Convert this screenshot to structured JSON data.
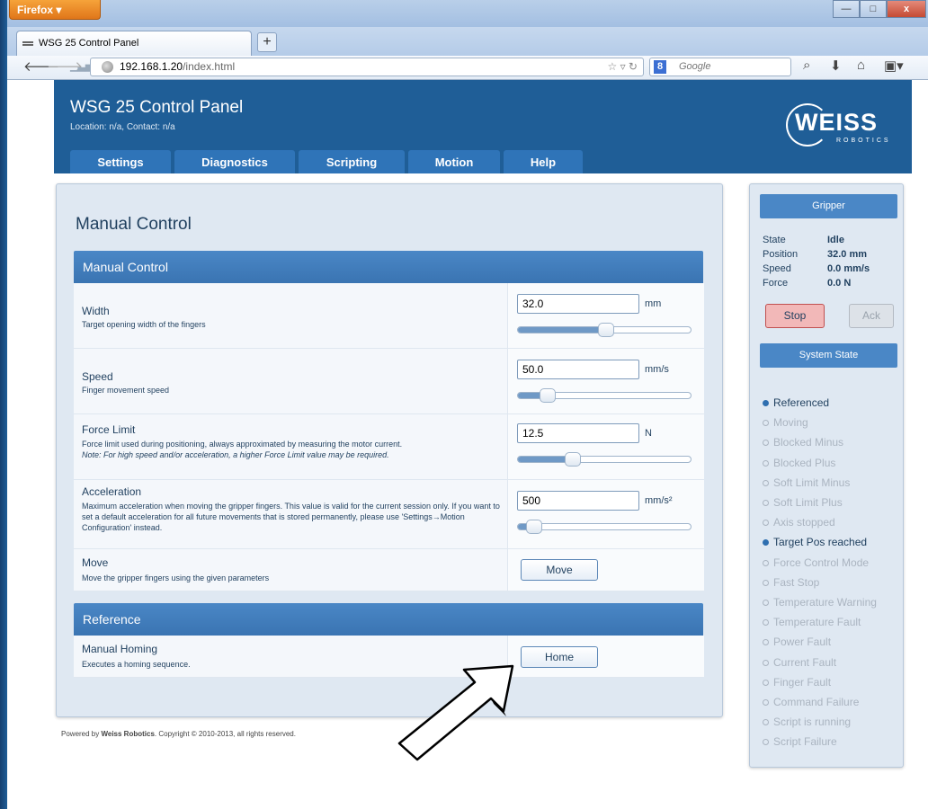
{
  "browser": {
    "menu_label": "Firefox ▾",
    "tab_title": "WSG 25 Control Panel",
    "new_tab": "+",
    "url_host": "192.168.1.20",
    "url_path": "/index.html",
    "search_placeholder": "Google",
    "window_min": "—",
    "window_max": "□",
    "window_close": "x"
  },
  "header": {
    "title": "WSG 25 Control Panel",
    "subtitle": "Location: n/a, Contact: n/a",
    "logo_text": "WEISS",
    "logo_sub": "ROBOTICS"
  },
  "nav": [
    "Settings",
    "Diagnostics",
    "Scripting",
    "Motion",
    "Help"
  ],
  "page_title": "Manual Control",
  "sections": {
    "manual": "Manual Control",
    "reference": "Reference"
  },
  "controls": {
    "width": {
      "label": "Width",
      "desc": "Target opening width of the fingers",
      "value": "32.0",
      "unit": "mm",
      "level": 0.51
    },
    "speed": {
      "label": "Speed",
      "desc": "Finger movement speed",
      "value": "50.0",
      "unit": "mm/s",
      "level": 0.14
    },
    "force": {
      "label": "Force Limit",
      "desc": "Force limit used during positioning, always approximated by measuring the motor current.",
      "note": "Note: For high speed and/or acceleration, a higher Force Limit value may be required.",
      "value": "12.5",
      "unit": "N",
      "level": 0.3
    },
    "accel": {
      "label": "Acceleration",
      "desc": "Maximum acceleration when moving the gripper fingers. This value is valid for the current session only. If you want to set a default acceleration for all future movements that is stored permanently, please use 'Settings→Motion Configuration' instead.",
      "value": "500",
      "unit": "mm/s²",
      "level": 0.05
    },
    "move": {
      "label": "Move",
      "desc": "Move the gripper fingers using the given parameters",
      "button": "Move"
    },
    "homing": {
      "label": "Manual Homing",
      "desc": "Executes a homing sequence.",
      "button": "Home"
    }
  },
  "footer": {
    "prefix": "Powered by ",
    "brand": "Weiss Robotics",
    "rest": ". Copyright © 2010-2013, all rights reserved."
  },
  "gripper": {
    "title": "Gripper",
    "rows": [
      {
        "label": "State",
        "value": "Idle"
      },
      {
        "label": "Position",
        "value": "32.0 mm"
      },
      {
        "label": "Speed",
        "value": "0.0 mm/s"
      },
      {
        "label": "Force",
        "value": "0.0 N"
      }
    ],
    "stop": "Stop",
    "ack": "Ack"
  },
  "system_state": {
    "title": "System State",
    "flags": [
      {
        "label": "Referenced",
        "on": true
      },
      {
        "label": "Moving",
        "on": false
      },
      {
        "label": "Blocked Minus",
        "on": false
      },
      {
        "label": "Blocked Plus",
        "on": false
      },
      {
        "label": "Soft Limit Minus",
        "on": false
      },
      {
        "label": "Soft Limit Plus",
        "on": false
      },
      {
        "label": "Axis stopped",
        "on": false
      },
      {
        "label": "Target Pos reached",
        "on": true
      },
      {
        "label": "Force Control Mode",
        "on": false
      },
      {
        "label": "Fast Stop",
        "on": false
      },
      {
        "label": "Temperature Warning",
        "on": false
      },
      {
        "label": "Temperature Fault",
        "on": false
      },
      {
        "label": "Power Fault",
        "on": false
      },
      {
        "label": "Current Fault",
        "on": false
      },
      {
        "label": "Finger Fault",
        "on": false
      },
      {
        "label": "Command Failure",
        "on": false
      },
      {
        "label": "Script is running",
        "on": false
      },
      {
        "label": "Script Failure",
        "on": false
      }
    ]
  },
  "colors": {
    "header": "#1f5e97",
    "accent": "#4a87c6",
    "stop": "#f2b8b8"
  }
}
